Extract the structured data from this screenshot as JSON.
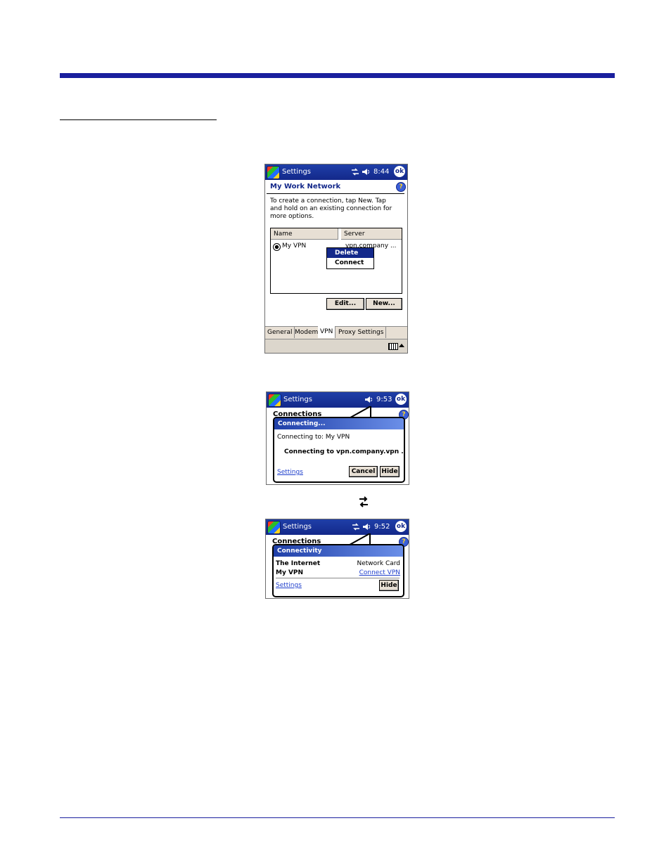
{
  "colors": {
    "accent": "#1a1f9e",
    "titlebar": "#13288a",
    "button_face": "#e7dfd4",
    "link": "#1f3fcc"
  },
  "screen1": {
    "title": "Settings",
    "time": "8:44",
    "ok": "ok",
    "help": "?",
    "subtitle": "My Work Network",
    "instructions": "To create a connection, tap New. Tap and hold on an existing connection for more options.",
    "columns": [
      "Name",
      "Server"
    ],
    "row": {
      "name": "My VPN",
      "server": "vpn.company ..."
    },
    "context_menu": [
      "Delete",
      "Connect"
    ],
    "buttons": {
      "edit": "Edit...",
      "new": "New..."
    },
    "tabs": [
      "General",
      "Modem",
      "VPN",
      "Proxy Settings"
    ],
    "icons": [
      "windows-start-icon",
      "connectivity-icon",
      "speaker-icon",
      "ok-icon",
      "help-icon",
      "keyboard-icon",
      "arrow-up-icon"
    ]
  },
  "screen2": {
    "title": "Settings",
    "time": "9:53",
    "ok": "ok",
    "help": "?",
    "background_heading": "Connections",
    "popup_title": "Connecting...",
    "connecting_to": "Connecting to: My VPN",
    "status": "Connecting to vpn.company.vpn ...",
    "settings_link": "Settings",
    "cancel": "Cancel",
    "hide": "Hide"
  },
  "screen3": {
    "title": "Settings",
    "time": "9:52",
    "ok": "ok",
    "help": "?",
    "background_heading": "Connections",
    "popup_title": "Connectivity",
    "rows": [
      {
        "name": "The Internet",
        "value": "Network Card"
      },
      {
        "name": "My VPN",
        "value": "Connect VPN"
      }
    ],
    "settings_link": "Settings",
    "hide": "Hide"
  }
}
